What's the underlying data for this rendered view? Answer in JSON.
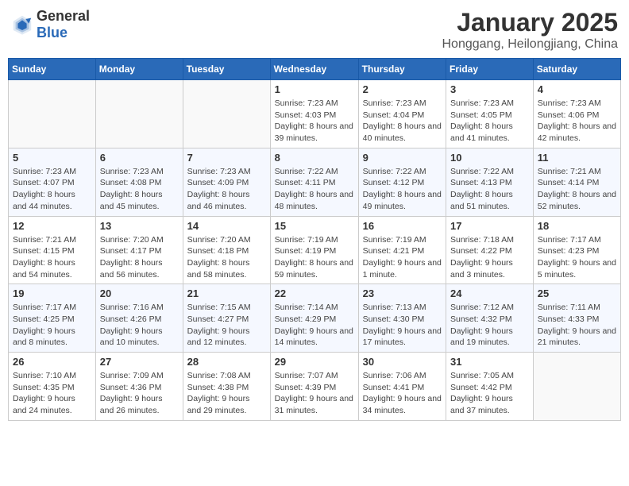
{
  "header": {
    "logo_general": "General",
    "logo_blue": "Blue",
    "title": "January 2025",
    "subtitle": "Honggang, Heilongjiang, China"
  },
  "calendar": {
    "weekdays": [
      "Sunday",
      "Monday",
      "Tuesday",
      "Wednesday",
      "Thursday",
      "Friday",
      "Saturday"
    ],
    "weeks": [
      [
        {
          "day": "",
          "info": ""
        },
        {
          "day": "",
          "info": ""
        },
        {
          "day": "",
          "info": ""
        },
        {
          "day": "1",
          "info": "Sunrise: 7:23 AM\nSunset: 4:03 PM\nDaylight: 8 hours and 39 minutes."
        },
        {
          "day": "2",
          "info": "Sunrise: 7:23 AM\nSunset: 4:04 PM\nDaylight: 8 hours and 40 minutes."
        },
        {
          "day": "3",
          "info": "Sunrise: 7:23 AM\nSunset: 4:05 PM\nDaylight: 8 hours and 41 minutes."
        },
        {
          "day": "4",
          "info": "Sunrise: 7:23 AM\nSunset: 4:06 PM\nDaylight: 8 hours and 42 minutes."
        }
      ],
      [
        {
          "day": "5",
          "info": "Sunrise: 7:23 AM\nSunset: 4:07 PM\nDaylight: 8 hours and 44 minutes."
        },
        {
          "day": "6",
          "info": "Sunrise: 7:23 AM\nSunset: 4:08 PM\nDaylight: 8 hours and 45 minutes."
        },
        {
          "day": "7",
          "info": "Sunrise: 7:23 AM\nSunset: 4:09 PM\nDaylight: 8 hours and 46 minutes."
        },
        {
          "day": "8",
          "info": "Sunrise: 7:22 AM\nSunset: 4:11 PM\nDaylight: 8 hours and 48 minutes."
        },
        {
          "day": "9",
          "info": "Sunrise: 7:22 AM\nSunset: 4:12 PM\nDaylight: 8 hours and 49 minutes."
        },
        {
          "day": "10",
          "info": "Sunrise: 7:22 AM\nSunset: 4:13 PM\nDaylight: 8 hours and 51 minutes."
        },
        {
          "day": "11",
          "info": "Sunrise: 7:21 AM\nSunset: 4:14 PM\nDaylight: 8 hours and 52 minutes."
        }
      ],
      [
        {
          "day": "12",
          "info": "Sunrise: 7:21 AM\nSunset: 4:15 PM\nDaylight: 8 hours and 54 minutes."
        },
        {
          "day": "13",
          "info": "Sunrise: 7:20 AM\nSunset: 4:17 PM\nDaylight: 8 hours and 56 minutes."
        },
        {
          "day": "14",
          "info": "Sunrise: 7:20 AM\nSunset: 4:18 PM\nDaylight: 8 hours and 58 minutes."
        },
        {
          "day": "15",
          "info": "Sunrise: 7:19 AM\nSunset: 4:19 PM\nDaylight: 8 hours and 59 minutes."
        },
        {
          "day": "16",
          "info": "Sunrise: 7:19 AM\nSunset: 4:21 PM\nDaylight: 9 hours and 1 minute."
        },
        {
          "day": "17",
          "info": "Sunrise: 7:18 AM\nSunset: 4:22 PM\nDaylight: 9 hours and 3 minutes."
        },
        {
          "day": "18",
          "info": "Sunrise: 7:17 AM\nSunset: 4:23 PM\nDaylight: 9 hours and 5 minutes."
        }
      ],
      [
        {
          "day": "19",
          "info": "Sunrise: 7:17 AM\nSunset: 4:25 PM\nDaylight: 9 hours and 8 minutes."
        },
        {
          "day": "20",
          "info": "Sunrise: 7:16 AM\nSunset: 4:26 PM\nDaylight: 9 hours and 10 minutes."
        },
        {
          "day": "21",
          "info": "Sunrise: 7:15 AM\nSunset: 4:27 PM\nDaylight: 9 hours and 12 minutes."
        },
        {
          "day": "22",
          "info": "Sunrise: 7:14 AM\nSunset: 4:29 PM\nDaylight: 9 hours and 14 minutes."
        },
        {
          "day": "23",
          "info": "Sunrise: 7:13 AM\nSunset: 4:30 PM\nDaylight: 9 hours and 17 minutes."
        },
        {
          "day": "24",
          "info": "Sunrise: 7:12 AM\nSunset: 4:32 PM\nDaylight: 9 hours and 19 minutes."
        },
        {
          "day": "25",
          "info": "Sunrise: 7:11 AM\nSunset: 4:33 PM\nDaylight: 9 hours and 21 minutes."
        }
      ],
      [
        {
          "day": "26",
          "info": "Sunrise: 7:10 AM\nSunset: 4:35 PM\nDaylight: 9 hours and 24 minutes."
        },
        {
          "day": "27",
          "info": "Sunrise: 7:09 AM\nSunset: 4:36 PM\nDaylight: 9 hours and 26 minutes."
        },
        {
          "day": "28",
          "info": "Sunrise: 7:08 AM\nSunset: 4:38 PM\nDaylight: 9 hours and 29 minutes."
        },
        {
          "day": "29",
          "info": "Sunrise: 7:07 AM\nSunset: 4:39 PM\nDaylight: 9 hours and 31 minutes."
        },
        {
          "day": "30",
          "info": "Sunrise: 7:06 AM\nSunset: 4:41 PM\nDaylight: 9 hours and 34 minutes."
        },
        {
          "day": "31",
          "info": "Sunrise: 7:05 AM\nSunset: 4:42 PM\nDaylight: 9 hours and 37 minutes."
        },
        {
          "day": "",
          "info": ""
        }
      ]
    ]
  }
}
